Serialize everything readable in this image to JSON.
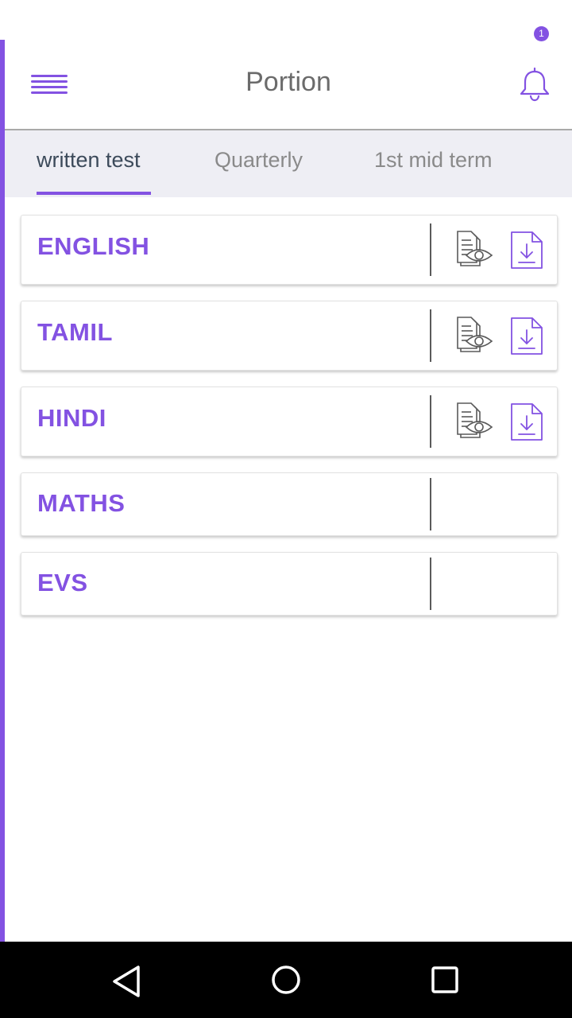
{
  "header": {
    "title": "Portion",
    "notification_count": "1"
  },
  "tabs": [
    {
      "label": "written test",
      "active": true
    },
    {
      "label": "Quarterly",
      "active": false
    },
    {
      "label": "1st mid term",
      "active": false
    }
  ],
  "subjects": [
    {
      "name": "ENGLISH",
      "has_actions": true
    },
    {
      "name": "TAMIL",
      "has_actions": true
    },
    {
      "name": "HINDI",
      "has_actions": true
    },
    {
      "name": "MATHS",
      "has_actions": false
    },
    {
      "name": "EVS",
      "has_actions": false
    }
  ],
  "icons": {
    "menu": "hamburger-icon",
    "notification": "bell-icon",
    "view": "document-view-icon",
    "download": "file-download-icon",
    "nav_back": "back-triangle-icon",
    "nav_home": "home-circle-icon",
    "nav_recents": "recents-square-icon"
  },
  "colors": {
    "accent": "#8352e2",
    "tab_bg": "#eeeef4",
    "title": "#6b6b6b",
    "active_tab_text": "#3c4a5a"
  }
}
